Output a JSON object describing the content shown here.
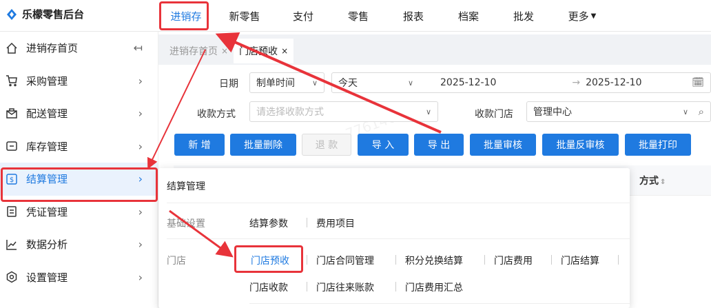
{
  "app": {
    "brand": "乐檬零售后台"
  },
  "topnav": {
    "items": [
      "进销存",
      "新零售",
      "支付",
      "零售",
      "报表",
      "档案",
      "批发",
      "更多"
    ]
  },
  "sidebar": {
    "items": [
      {
        "label": "进销存首页",
        "icon": "home-icon"
      },
      {
        "label": "采购管理",
        "icon": "cart-icon"
      },
      {
        "label": "配送管理",
        "icon": "mail-icon"
      },
      {
        "label": "库存管理",
        "icon": "inventory-icon"
      },
      {
        "label": "结算管理",
        "icon": "dollar-icon"
      },
      {
        "label": "凭证管理",
        "icon": "document-icon"
      },
      {
        "label": "数据分析",
        "icon": "chart-icon"
      },
      {
        "label": "设置管理",
        "icon": "gear-icon"
      }
    ],
    "collapse_glyph": "↤"
  },
  "tabs": [
    {
      "label": "进销存首页",
      "close": "×"
    },
    {
      "label": "门店预收",
      "close": "×"
    }
  ],
  "filters": {
    "date_label": "日期",
    "date_type": "制单时间",
    "date_range": "今天",
    "date_start": "2025-12-10",
    "date_arrow": "→",
    "date_end": "2025-12-10",
    "pay_method_label": "收款方式",
    "pay_method_placeholder": "请选择收款方式",
    "store_label": "收款门店",
    "store_value": "管理中心"
  },
  "buttons": [
    "新 增",
    "批量删除",
    "退 款",
    "导 入",
    "导 出",
    "批量审核",
    "批量反审核",
    "批量打印"
  ],
  "table": {
    "visible_header": "方式"
  },
  "popup": {
    "title": "结算管理",
    "groups": [
      {
        "name": "基础设置",
        "links": [
          "结算参数",
          "费用项目"
        ]
      },
      {
        "name": "门店",
        "links": [
          "门店预收",
          "门店合同管理",
          "积分兑换结算",
          "门店费用",
          "门店结算",
          "门店收款",
          "门店往来账款",
          "门店费用汇总"
        ]
      }
    ]
  },
  "watermark": "776140",
  "colors": {
    "accent": "#1f7ae0",
    "annotation": "#e8333a"
  }
}
